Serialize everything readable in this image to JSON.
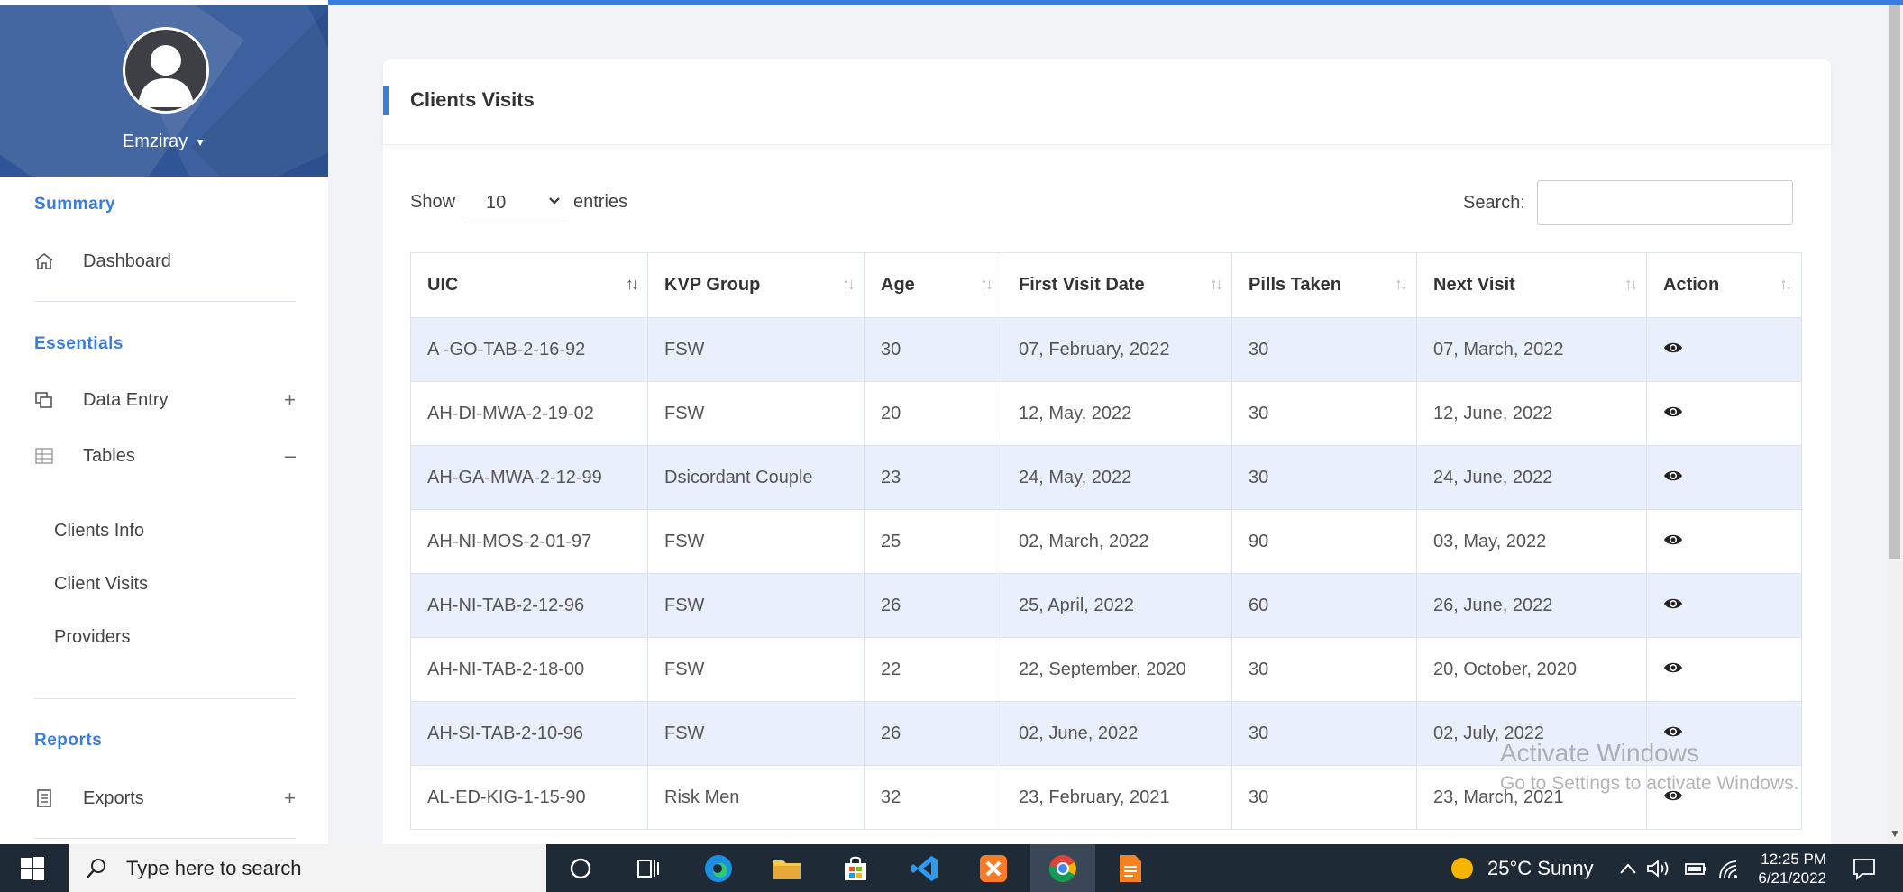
{
  "user": {
    "name": "Emziray"
  },
  "sidebar": {
    "sections": {
      "summary": "Summary",
      "essentials": "Essentials",
      "reports": "Reports"
    },
    "dashboard": "Dashboard",
    "data_entry": "Data Entry",
    "tables": "Tables",
    "sub_items": [
      "Clients Info",
      "Client Visits",
      "Providers"
    ],
    "exports": "Exports",
    "plus": "+",
    "minus": "–"
  },
  "page": {
    "title": "Clients Visits",
    "show_label": "Show",
    "entries_value": "10",
    "entries_label": "entries",
    "search_label": "Search:",
    "search_value": ""
  },
  "table": {
    "columns": [
      "UIC",
      "KVP Group",
      "Age",
      "First Visit Date",
      "Pills Taken",
      "Next Visit",
      "Action"
    ],
    "rows": [
      [
        "A -GO-TAB-2-16-92",
        "FSW",
        "30",
        "07, February, 2022",
        "30",
        "07, March, 2022"
      ],
      [
        "AH-DI-MWA-2-19-02",
        "FSW",
        "20",
        "12, May, 2022",
        "30",
        "12, June, 2022"
      ],
      [
        "AH-GA-MWA-2-12-99",
        "Dsicordant Couple",
        "23",
        "24, May, 2022",
        "30",
        "24, June, 2022"
      ],
      [
        "AH-NI-MOS-2-01-97",
        "FSW",
        "25",
        "02, March, 2022",
        "90",
        "03, May, 2022"
      ],
      [
        "AH-NI-TAB-2-12-96",
        "FSW",
        "26",
        "25, April, 2022",
        "60",
        "26, June, 2022"
      ],
      [
        "AH-NI-TAB-2-18-00",
        "FSW",
        "22",
        "22, September, 2020",
        "30",
        "20, October, 2020"
      ],
      [
        "AH-SI-TAB-2-10-96",
        "FSW",
        "26",
        "02, June, 2022",
        "30",
        "02, July, 2022"
      ],
      [
        "AL-ED-KIG-1-15-90",
        "Risk Men",
        "32",
        "23, February, 2021",
        "30",
        "23, March, 2021"
      ]
    ]
  },
  "watermark": {
    "line1": "Activate Windows",
    "line2": "Go to Settings to activate Windows."
  },
  "taskbar": {
    "search_placeholder": "Type here to search",
    "weather": "25°C  Sunny",
    "time": "12:25 PM",
    "date": "6/21/2022"
  }
}
